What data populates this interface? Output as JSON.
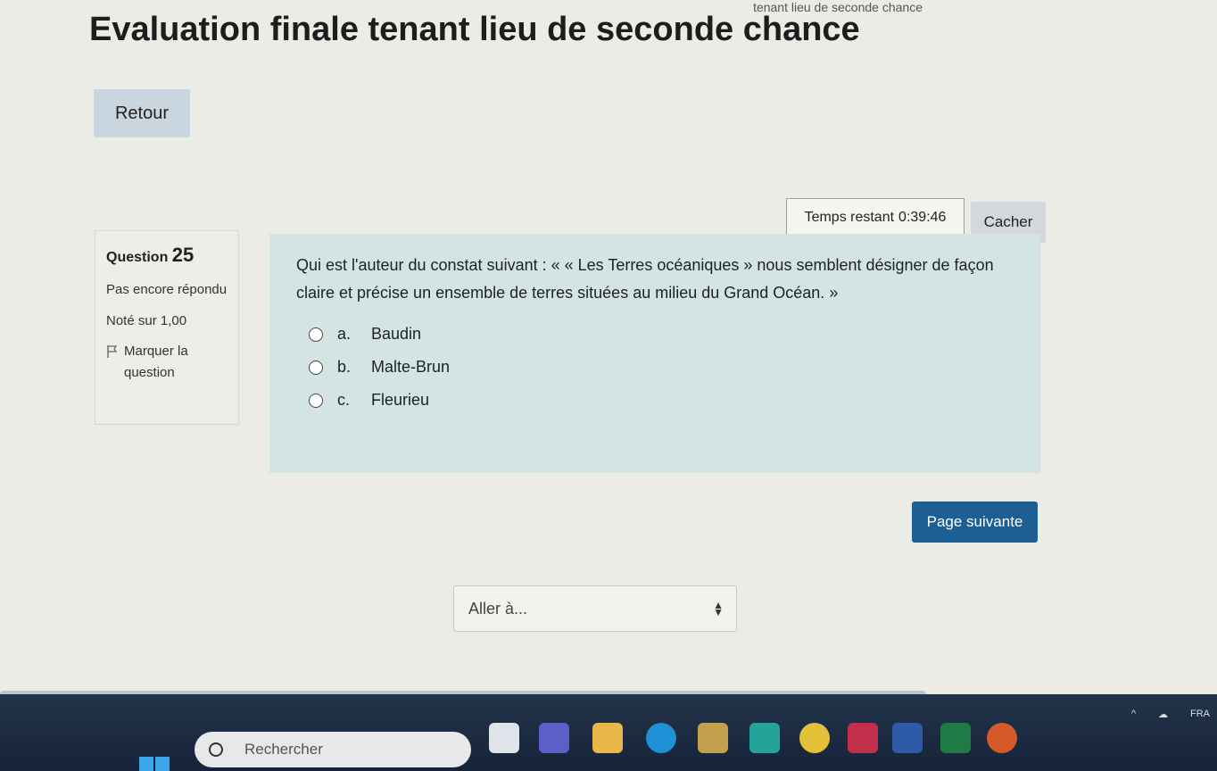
{
  "breadcrumb_fragment": "tenant lieu de seconde chance",
  "page_title": "Evaluation finale tenant lieu de seconde chance",
  "back_button": "Retour",
  "timer": {
    "label": "Temps restant",
    "value": "0:39:46",
    "hide_button": "Cacher"
  },
  "question_info": {
    "label": "Question",
    "number": "25",
    "status": "Pas encore répondu",
    "grade": "Noté sur 1,00",
    "flag": "Marquer la question"
  },
  "question": {
    "text": "Qui est l'auteur du constat suivant : « « Les Terres océaniques » nous semblent désigner de façon claire et précise un ensemble de terres situées au milieu du Grand Océan. »",
    "answers": [
      {
        "letter": "a.",
        "text": "Baudin"
      },
      {
        "letter": "b.",
        "text": "Malte-Brun"
      },
      {
        "letter": "c.",
        "text": "Fleurieu"
      }
    ]
  },
  "next_button": "Page suivante",
  "jump_select": {
    "value": "Aller à..."
  },
  "taskbar": {
    "search_placeholder": "Rechercher",
    "language": "FRA",
    "tray_chevron": "^",
    "accent_colors": [
      "#3aa7e8",
      "#c2a14d",
      "#23a39a",
      "#2e5aa8",
      "#1f7a45"
    ]
  }
}
